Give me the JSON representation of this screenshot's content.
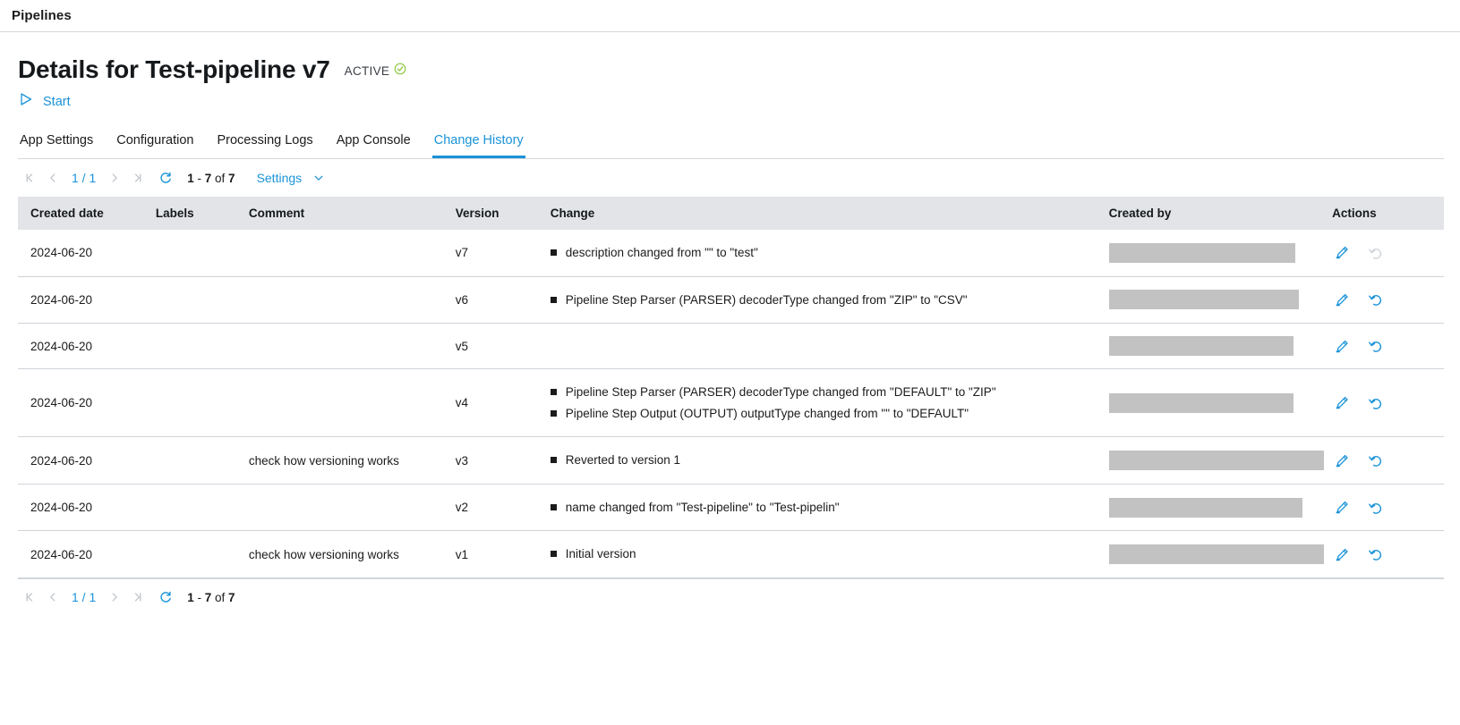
{
  "appbar": {
    "title": "Pipelines"
  },
  "header": {
    "page_title": "Details for Test-pipeline v7",
    "status": "ACTIVE",
    "status_icon": "circle-check-icon",
    "status_color": "#8cc63e",
    "start_label": "Start",
    "start_icon": "play-triangle-icon",
    "accent_color": "#1a93d8"
  },
  "tabs": [
    {
      "label": "App Settings",
      "active": false
    },
    {
      "label": "Configuration",
      "active": false
    },
    {
      "label": "Processing Logs",
      "active": false
    },
    {
      "label": "App Console",
      "active": false
    },
    {
      "label": "Change History",
      "active": true
    }
  ],
  "toolbar": {
    "first_icon": "first-page-icon",
    "prev_icon": "prev-page-icon",
    "pages": "1 / 1",
    "next_icon": "next-page-icon",
    "last_icon": "last-page-icon",
    "refresh_icon": "refresh-icon",
    "count_prefix": "1",
    "count_sep": " - ",
    "count_end": "7",
    "count_of": " of ",
    "count_total": "7",
    "settings_label": "Settings",
    "settings_caret_icon": "chevron-down-icon"
  },
  "table": {
    "columns": [
      "Created date",
      "Labels",
      "Comment",
      "Version",
      "Change",
      "Created by",
      "Actions"
    ],
    "rows": [
      {
        "created_date": "2024-06-20",
        "labels": "",
        "comment": "",
        "version": "v7",
        "changes": [
          "description changed from \"\" to \"test\""
        ],
        "created_by_redacted": true,
        "created_by_width": 208,
        "edit_icon": "pencil-icon",
        "revert_icon": "undo-arrow-icon",
        "revert_enabled": false
      },
      {
        "created_date": "2024-06-20",
        "labels": "",
        "comment": "",
        "version": "v6",
        "changes": [
          "Pipeline Step Parser (PARSER) decoderType changed from \"ZIP\" to \"CSV\""
        ],
        "created_by_redacted": true,
        "created_by_width": 212,
        "edit_icon": "pencil-icon",
        "revert_icon": "undo-arrow-icon",
        "revert_enabled": true
      },
      {
        "created_date": "2024-06-20",
        "labels": "",
        "comment": "",
        "version": "v5",
        "changes": [],
        "created_by_redacted": true,
        "created_by_width": 206,
        "edit_icon": "pencil-icon",
        "revert_icon": "undo-arrow-icon",
        "revert_enabled": true
      },
      {
        "created_date": "2024-06-20",
        "labels": "",
        "comment": "",
        "version": "v4",
        "changes": [
          "Pipeline Step Parser (PARSER) decoderType changed from \"DEFAULT\" to \"ZIP\"",
          "Pipeline Step Output (OUTPUT) outputType changed from \"\" to \"DEFAULT\""
        ],
        "created_by_redacted": true,
        "created_by_width": 206,
        "edit_icon": "pencil-icon",
        "revert_icon": "undo-arrow-icon",
        "revert_enabled": true
      },
      {
        "created_date": "2024-06-20",
        "labels": "",
        "comment": "check how versioning works",
        "version": "v3",
        "changes": [
          "Reverted to version 1"
        ],
        "created_by_redacted": true,
        "created_by_width": 240,
        "edit_icon": "pencil-icon",
        "revert_icon": "undo-arrow-icon",
        "revert_enabled": true
      },
      {
        "created_date": "2024-06-20",
        "labels": "",
        "comment": "",
        "version": "v2",
        "changes": [
          "name changed from \"Test-pipeline\" to \"Test-pipelin\""
        ],
        "created_by_redacted": true,
        "created_by_width": 216,
        "edit_icon": "pencil-icon",
        "revert_icon": "undo-arrow-icon",
        "revert_enabled": true
      },
      {
        "created_date": "2024-06-20",
        "labels": "",
        "comment": "check how versioning works",
        "version": "v1",
        "changes": [
          "Initial version"
        ],
        "created_by_redacted": true,
        "created_by_width": 240,
        "edit_icon": "pencil-icon",
        "revert_icon": "undo-arrow-icon",
        "revert_enabled": true
      }
    ]
  },
  "toolbar_bottom": {
    "first_icon": "first-page-icon",
    "prev_icon": "prev-page-icon",
    "pages": "1 / 1",
    "next_icon": "next-page-icon",
    "last_icon": "last-page-icon",
    "refresh_icon": "refresh-icon",
    "count_prefix": "1",
    "count_sep": " - ",
    "count_end": "7",
    "count_of": " of ",
    "count_total": "7"
  }
}
